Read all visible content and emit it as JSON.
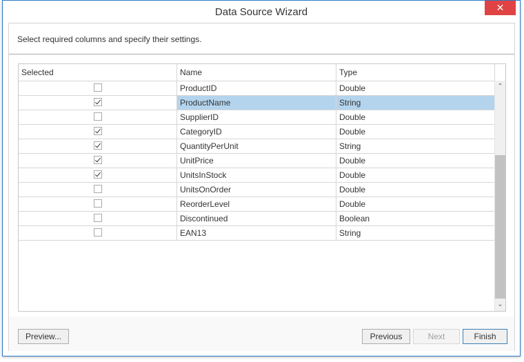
{
  "window": {
    "title": "Data Source Wizard",
    "close_icon": "close-icon",
    "close_glyph": "✕"
  },
  "header": {
    "instruction": "Select required columns and specify their settings."
  },
  "grid": {
    "columns": [
      "Selected",
      "Name",
      "Type"
    ],
    "rows": [
      {
        "selected": false,
        "name": "ProductID",
        "type": "Double",
        "highlighted": false
      },
      {
        "selected": true,
        "name": "ProductName",
        "type": "String",
        "highlighted": true
      },
      {
        "selected": false,
        "name": "SupplierID",
        "type": "Double",
        "highlighted": false
      },
      {
        "selected": true,
        "name": "CategoryID",
        "type": "Double",
        "highlighted": false
      },
      {
        "selected": true,
        "name": "QuantityPerUnit",
        "type": "String",
        "highlighted": false
      },
      {
        "selected": true,
        "name": "UnitPrice",
        "type": "Double",
        "highlighted": false
      },
      {
        "selected": true,
        "name": "UnitsInStock",
        "type": "Double",
        "highlighted": false
      },
      {
        "selected": false,
        "name": "UnitsOnOrder",
        "type": "Double",
        "highlighted": false
      },
      {
        "selected": false,
        "name": "ReorderLevel",
        "type": "Double",
        "highlighted": false
      },
      {
        "selected": false,
        "name": "Discontinued",
        "type": "Boolean",
        "highlighted": false
      },
      {
        "selected": false,
        "name": "EAN13",
        "type": "String",
        "highlighted": false
      }
    ],
    "scroll_up_glyph": "⌃",
    "scroll_down_glyph": "⌄"
  },
  "footer": {
    "preview_label": "Preview...",
    "previous_label": "Previous",
    "next_label": "Next",
    "next_enabled": false,
    "finish_label": "Finish"
  },
  "colors": {
    "close_button": "#e04343",
    "selection_highlight": "#b4d4ee",
    "window_border": "#2b7bc7",
    "default_button_border": "#3c7fb1"
  }
}
